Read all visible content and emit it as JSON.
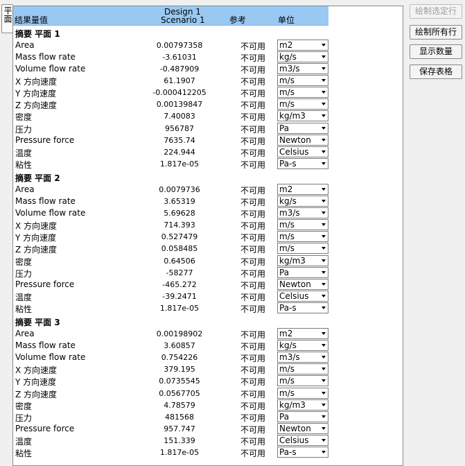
{
  "side_tab": "平面",
  "header": {
    "name_col": "结果量值",
    "design": "Design 1",
    "scenario": "Scenario 1",
    "ref_col": "参考",
    "unit_col": "单位"
  },
  "buttons": [
    {
      "label": "绘制选定行",
      "enabled": false
    },
    {
      "label": "绘制所有行",
      "enabled": true
    },
    {
      "label": "显示数量",
      "enabled": true
    },
    {
      "label": "保存表格",
      "enabled": true
    }
  ],
  "sections": [
    {
      "title": "摘要 平面 1",
      "rows": [
        {
          "name": "Area",
          "value": "0.00797358",
          "ref": "不可用",
          "unit": "m2"
        },
        {
          "name": "Mass flow rate",
          "value": "-3.61031",
          "ref": "不可用",
          "unit": "kg/s"
        },
        {
          "name": "Volume flow rate",
          "value": "-0.487909",
          "ref": "不可用",
          "unit": "m3/s"
        },
        {
          "name": "X 方向速度",
          "value": "61.1907",
          "ref": "不可用",
          "unit": "m/s"
        },
        {
          "name": "Y 方向速度",
          "value": "-0.000412205",
          "ref": "不可用",
          "unit": "m/s"
        },
        {
          "name": "Z 方向速度",
          "value": "0.00139847",
          "ref": "不可用",
          "unit": "m/s"
        },
        {
          "name": "密度",
          "value": "7.40083",
          "ref": "不可用",
          "unit": "kg/m3"
        },
        {
          "name": "压力",
          "value": "956787",
          "ref": "不可用",
          "unit": "Pa"
        },
        {
          "name": "Pressure force",
          "value": "7635.74",
          "ref": "不可用",
          "unit": "Newton"
        },
        {
          "name": "温度",
          "value": "224.944",
          "ref": "不可用",
          "unit": "Celsius"
        },
        {
          "name": "粘性",
          "value": "1.817e-05",
          "ref": "不可用",
          "unit": "Pa-s"
        }
      ]
    },
    {
      "title": "摘要 平面 2",
      "rows": [
        {
          "name": "Area",
          "value": "0.0079736",
          "ref": "不可用",
          "unit": "m2"
        },
        {
          "name": "Mass flow rate",
          "value": "3.65319",
          "ref": "不可用",
          "unit": "kg/s"
        },
        {
          "name": "Volume flow rate",
          "value": "5.69628",
          "ref": "不可用",
          "unit": "m3/s"
        },
        {
          "name": "X 方向速度",
          "value": "714.393",
          "ref": "不可用",
          "unit": "m/s"
        },
        {
          "name": "Y 方向速度",
          "value": "0.527479",
          "ref": "不可用",
          "unit": "m/s"
        },
        {
          "name": "Z 方向速度",
          "value": "0.058485",
          "ref": "不可用",
          "unit": "m/s"
        },
        {
          "name": "密度",
          "value": "0.64506",
          "ref": "不可用",
          "unit": "kg/m3"
        },
        {
          "name": "压力",
          "value": "-58277",
          "ref": "不可用",
          "unit": "Pa"
        },
        {
          "name": "Pressure force",
          "value": "-465.272",
          "ref": "不可用",
          "unit": "Newton"
        },
        {
          "name": "温度",
          "value": "-39.2471",
          "ref": "不可用",
          "unit": "Celsius"
        },
        {
          "name": "粘性",
          "value": "1.817e-05",
          "ref": "不可用",
          "unit": "Pa-s"
        }
      ]
    },
    {
      "title": "摘要 平面 3",
      "rows": [
        {
          "name": "Area",
          "value": "0.00198902",
          "ref": "不可用",
          "unit": "m2"
        },
        {
          "name": "Mass flow rate",
          "value": "3.60857",
          "ref": "不可用",
          "unit": "kg/s"
        },
        {
          "name": "Volume flow rate",
          "value": "0.754226",
          "ref": "不可用",
          "unit": "m3/s"
        },
        {
          "name": "X 方向速度",
          "value": "379.195",
          "ref": "不可用",
          "unit": "m/s"
        },
        {
          "name": "Y 方向速度",
          "value": "0.0735545",
          "ref": "不可用",
          "unit": "m/s"
        },
        {
          "name": "Z 方向速度",
          "value": "0.0567705",
          "ref": "不可用",
          "unit": "m/s"
        },
        {
          "name": "密度",
          "value": "4.78579",
          "ref": "不可用",
          "unit": "kg/m3"
        },
        {
          "name": "压力",
          "value": "481568",
          "ref": "不可用",
          "unit": "Pa"
        },
        {
          "name": "Pressure force",
          "value": "957.747",
          "ref": "不可用",
          "unit": "Newton"
        },
        {
          "name": "温度",
          "value": "151.339",
          "ref": "不可用",
          "unit": "Celsius"
        },
        {
          "name": "粘性",
          "value": "1.817e-05",
          "ref": "不可用",
          "unit": "Pa-s"
        }
      ]
    }
  ]
}
